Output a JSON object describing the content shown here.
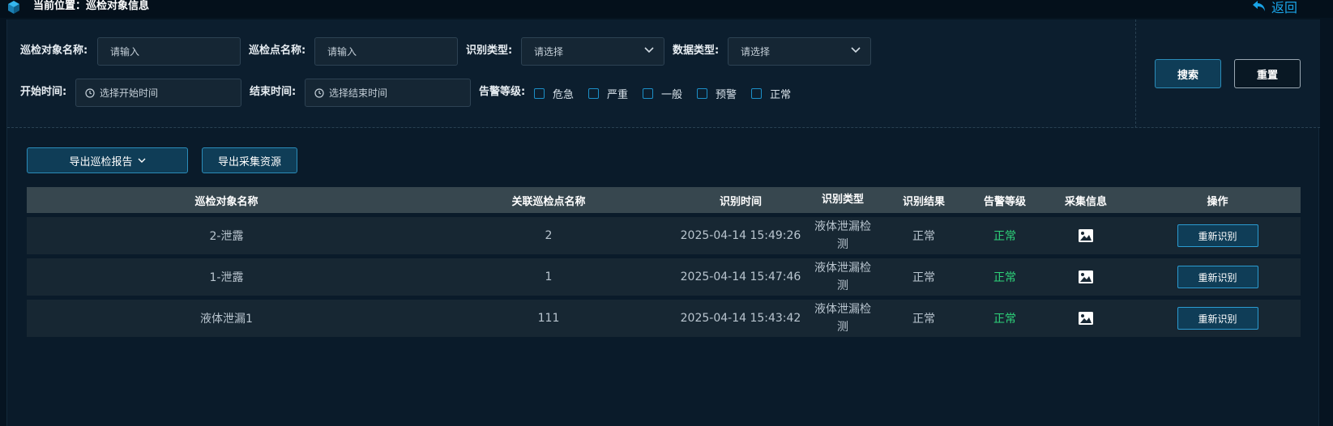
{
  "header": {
    "breadcrumb": "当前位置：巡检对象信息",
    "back_label": "返回"
  },
  "filters": {
    "object_name_label": "巡检对象名称:",
    "object_name_placeholder": "请输入",
    "point_name_label": "巡检点名称:",
    "point_name_placeholder": "请输入",
    "recog_type_label": "识别类型:",
    "recog_type_value": "请选择",
    "data_type_label": "数据类型:",
    "data_type_value": "请选择",
    "start_label": "开始时间:",
    "start_placeholder": "选择开始时间",
    "end_label": "结束时间:",
    "end_placeholder": "选择结束时间",
    "alarm_label": "告警等级:",
    "alarm_levels": [
      "危急",
      "严重",
      "一般",
      "预警",
      "正常"
    ],
    "search_label": "搜索",
    "reset_label": "重置"
  },
  "actions": {
    "export_report_label": "导出巡检报告",
    "export_resource_label": "导出采集资源"
  },
  "table": {
    "headers": [
      "巡检对象名称",
      "关联巡检点名称",
      "识别时间",
      "识别类型",
      "识别结果",
      "告警等级",
      "采集信息",
      "操作"
    ],
    "rows": [
      {
        "name": "2-泄露",
        "point": "2",
        "time": "2025-04-14 15:49:26",
        "type_line1": "液体泄漏检",
        "type_line2": "测",
        "result": "正常",
        "level": "正常",
        "action": "重新识别"
      },
      {
        "name": "1-泄露",
        "point": "1",
        "time": "2025-04-14 15:47:46",
        "type_line1": "液体泄漏检",
        "type_line2": "测",
        "result": "正常",
        "level": "正常",
        "action": "重新识别"
      },
      {
        "name": "液体泄漏1",
        "point": "111",
        "time": "2025-04-14 15:43:42",
        "type_line1": "液体泄漏检",
        "type_line2": "测",
        "result": "正常",
        "level": "正常",
        "action": "重新识别"
      }
    ]
  },
  "colors": {
    "accent": "#1aa3e6",
    "ok_level": "#2ed37a",
    "background": "#061421"
  }
}
